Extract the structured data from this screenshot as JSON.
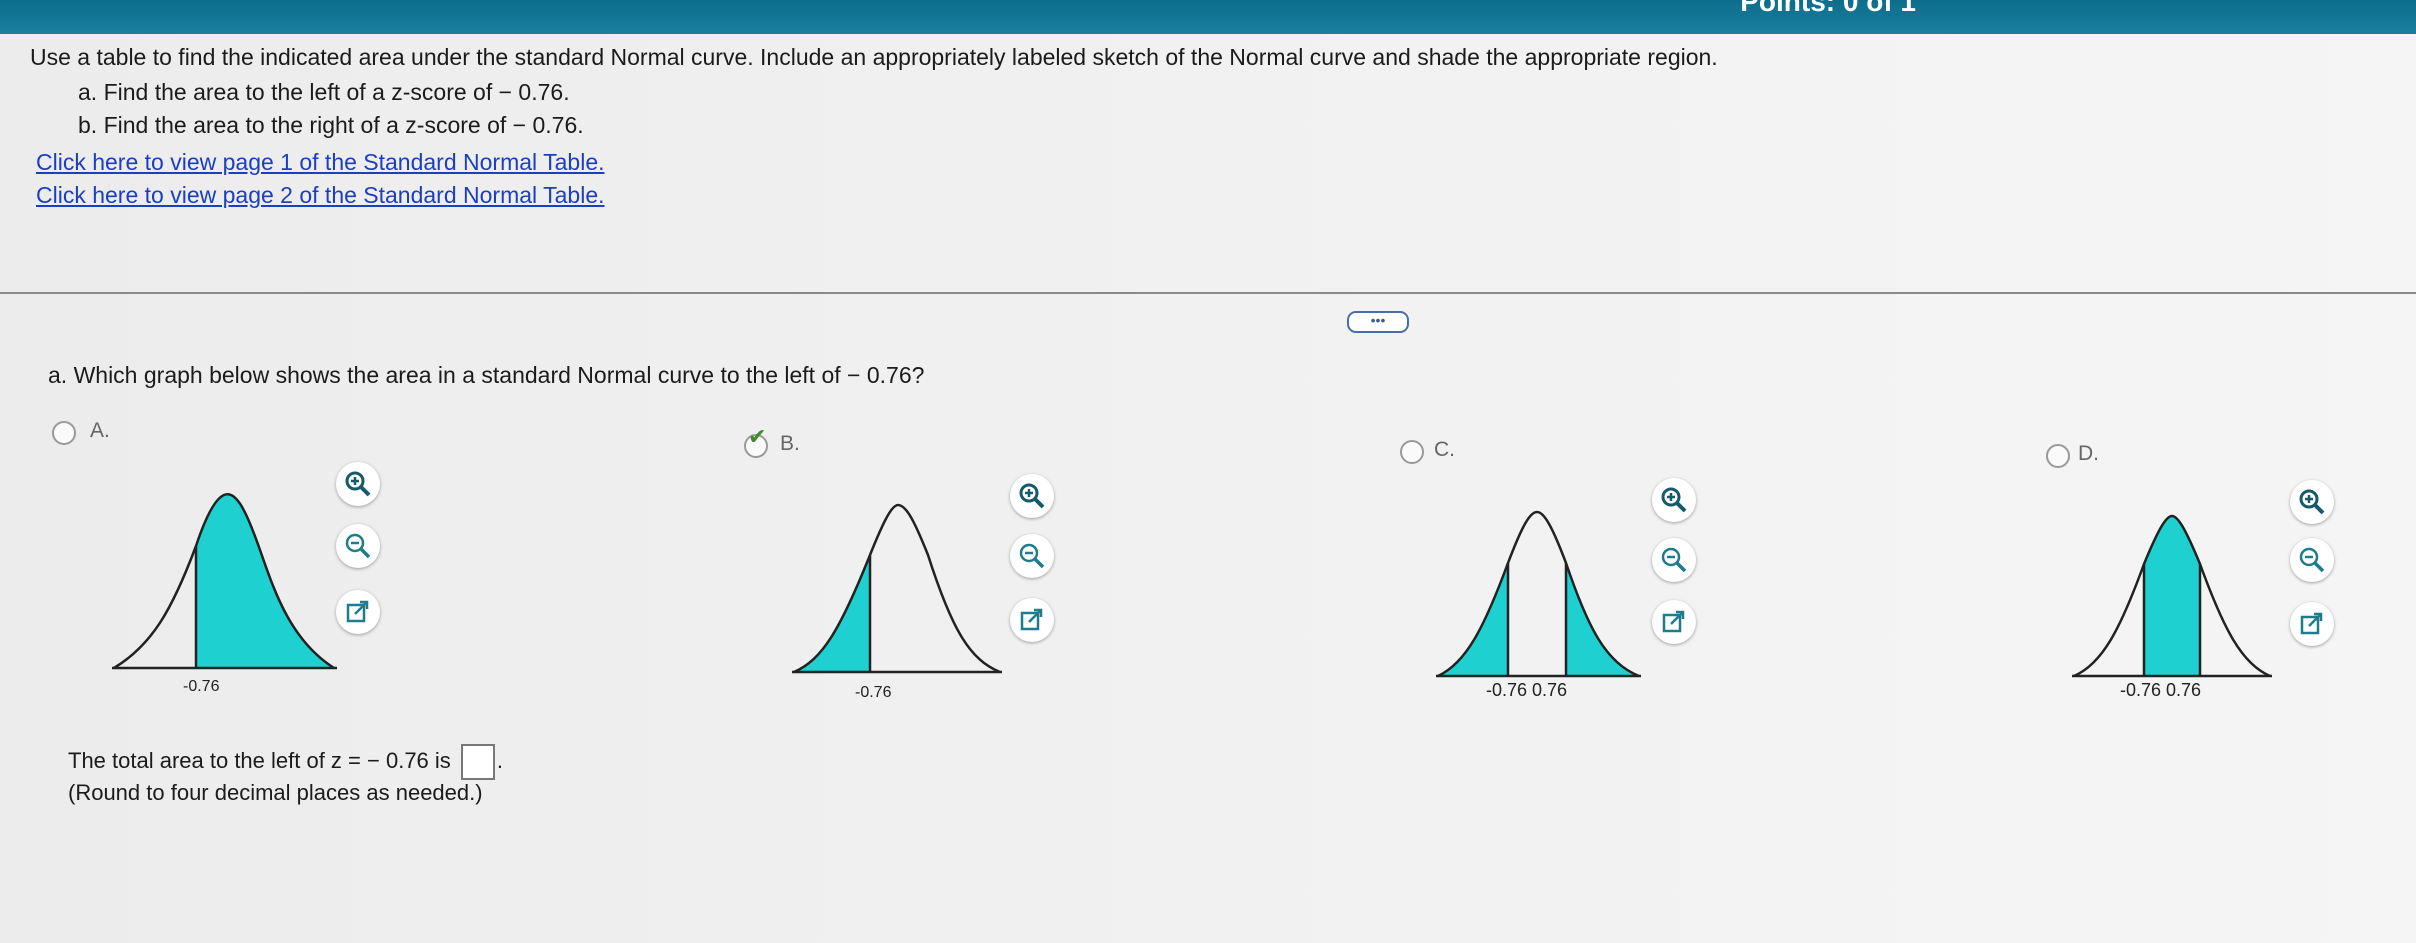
{
  "header": {
    "points_text": "Points: 0 of 1"
  },
  "question": {
    "intro": "Use a table to find the indicated area under the standard Normal curve. Include an appropriately labeled sketch of the Normal curve and shade the appropriate region.",
    "part_a": "a. Find the area to the left of a z-score of − 0.76.",
    "part_b": "b. Find the area to the right of a z-score of − 0.76.",
    "link1": "Click here to view page 1 of the Standard Normal Table.",
    "link2": "Click here to view page 2 of the Standard Normal Table."
  },
  "more_button": "•••",
  "subquestion": "a. Which graph below shows the area in a standard Normal curve to the left of − 0.76?",
  "options": [
    {
      "label": "A.",
      "selected": false,
      "tick_label": "-0.76"
    },
    {
      "label": "B.",
      "selected": true,
      "tick_label": "-0.76"
    },
    {
      "label": "C.",
      "selected": false,
      "tick_label": "-0.76  0.76"
    },
    {
      "label": "D.",
      "selected": false,
      "tick_label": "-0.76  0.76"
    }
  ],
  "answer": {
    "prompt": "The total area to the left of z = − 0.76 is",
    "suffix": ".",
    "note": "(Round to four decimal places as needed.)"
  },
  "colors": {
    "shade": "#1fd0d0",
    "link": "#1b3fbf",
    "topbar": "#0d6d8c",
    "check": "#3f8a2a"
  },
  "icons": [
    "zoom-in-icon",
    "zoom-out-icon",
    "popout-icon"
  ]
}
